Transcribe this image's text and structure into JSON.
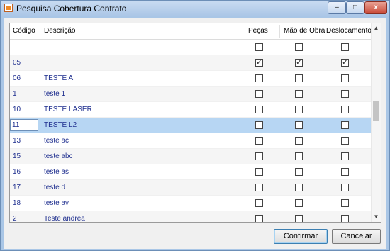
{
  "window": {
    "title": "Pesquisa Cobertura Contrato",
    "controls": {
      "minimize": "–",
      "maximize": "□",
      "close": "x"
    }
  },
  "grid": {
    "columns": [
      "Código",
      "Descrição",
      "Peças",
      "Mão de Obra",
      "Deslocamento"
    ],
    "rows": [
      {
        "code": "",
        "desc": "",
        "pecas": false,
        "mao": false,
        "desl": false,
        "selected": false
      },
      {
        "code": "05",
        "desc": "",
        "pecas": true,
        "mao": true,
        "desl": true,
        "selected": false
      },
      {
        "code": "06",
        "desc": "TESTE A",
        "pecas": false,
        "mao": false,
        "desl": false,
        "selected": false
      },
      {
        "code": "1",
        "desc": "teste 1",
        "pecas": false,
        "mao": false,
        "desl": false,
        "selected": false
      },
      {
        "code": "10",
        "desc": "TESTE LASER",
        "pecas": false,
        "mao": false,
        "desl": false,
        "selected": false
      },
      {
        "code": "11",
        "desc": "TESTE L2",
        "pecas": false,
        "mao": false,
        "desl": false,
        "selected": true
      },
      {
        "code": "13",
        "desc": "teste ac",
        "pecas": false,
        "mao": false,
        "desl": false,
        "selected": false
      },
      {
        "code": "15",
        "desc": "teste abc",
        "pecas": false,
        "mao": false,
        "desl": false,
        "selected": false
      },
      {
        "code": "16",
        "desc": "teste as",
        "pecas": false,
        "mao": false,
        "desl": false,
        "selected": false
      },
      {
        "code": "17",
        "desc": "teste d",
        "pecas": false,
        "mao": false,
        "desl": false,
        "selected": false
      },
      {
        "code": "18",
        "desc": "teste av",
        "pecas": false,
        "mao": false,
        "desl": false,
        "selected": false
      },
      {
        "code": "2",
        "desc": "Teste andrea",
        "pecas": false,
        "mao": false,
        "desl": false,
        "selected": false
      }
    ]
  },
  "buttons": {
    "confirm": "Confirmar",
    "cancel": "Cancelar"
  },
  "icons": {
    "app": "app-icon",
    "scroll_up": "▲",
    "scroll_down": "▼"
  }
}
